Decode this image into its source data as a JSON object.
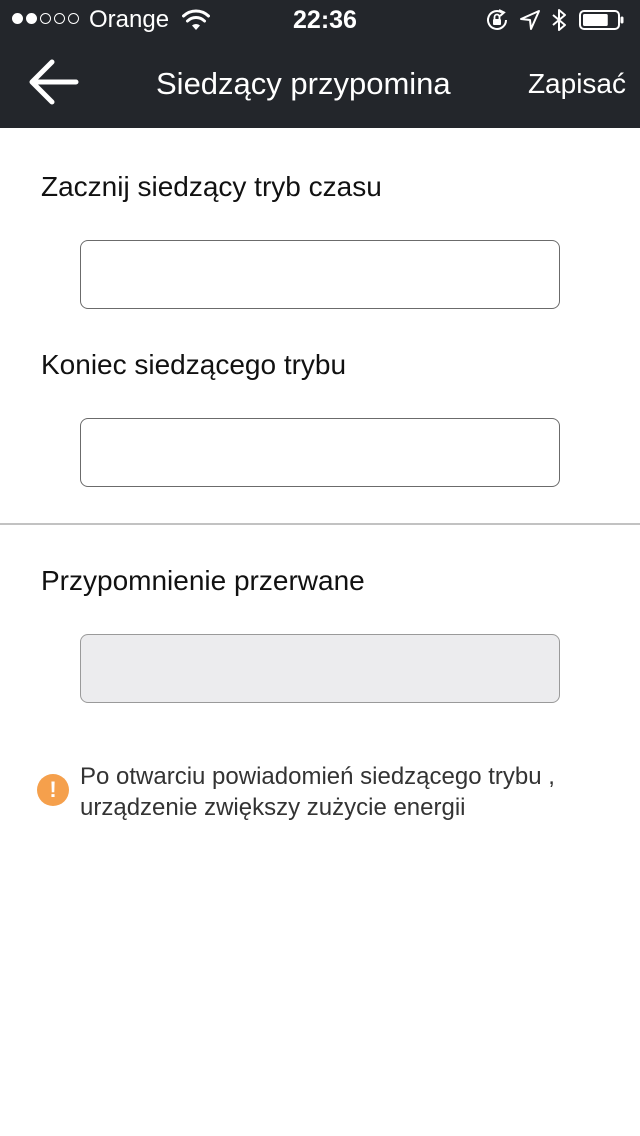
{
  "status_bar": {
    "carrier": "Orange",
    "time": "22:36",
    "signal_bars": 2,
    "signal_total": 5,
    "battery_level": 0.75
  },
  "nav": {
    "title": "Siedzący przypomina",
    "save_label": "Zapisać",
    "back_icon": "arrow-left-icon"
  },
  "form": {
    "start_label": "Zacznij siedzący tryb czasu",
    "start_value": "",
    "end_label": "Koniec siedzącego trybu",
    "end_value": "",
    "break_label": "Przypomnienie przerwane",
    "break_value": ""
  },
  "note": {
    "icon": "warning-icon",
    "text": "Po otwarciu powiadomień siedzącego trybu , urządzenie zwiększy zużycie energii"
  },
  "colors": {
    "bar_background": "#23262b",
    "warning": "#f5a04c",
    "disabled_field": "#ececee"
  }
}
